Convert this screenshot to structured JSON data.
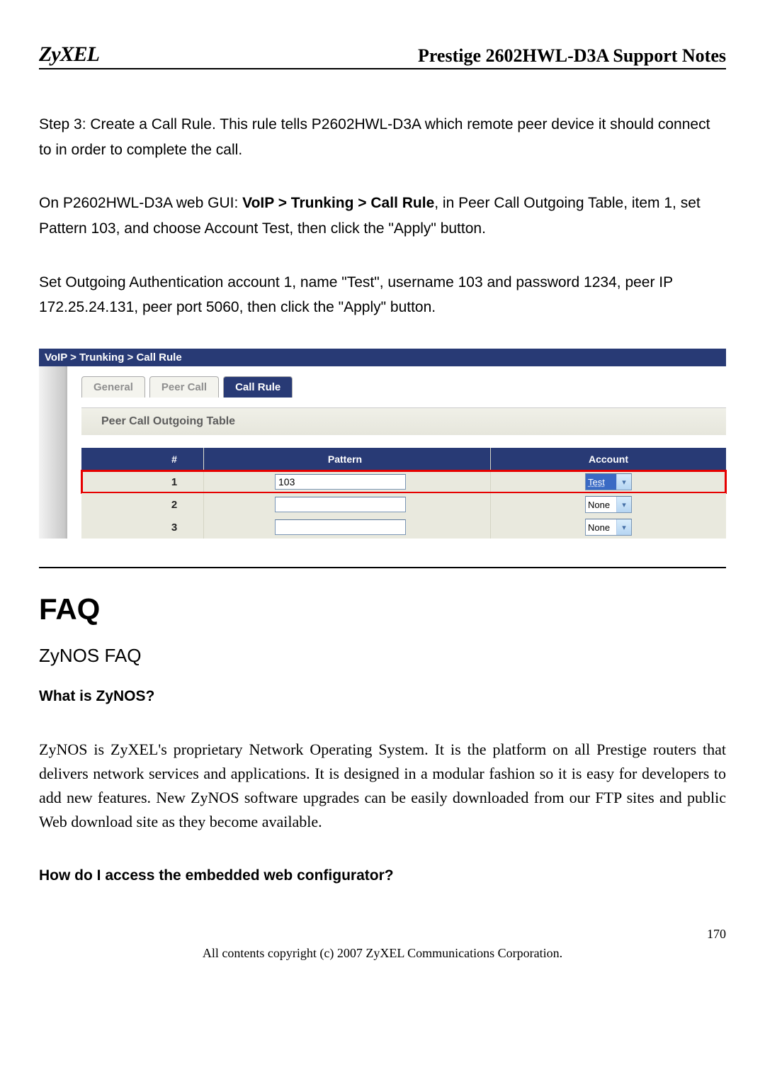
{
  "header": {
    "logo": "ZyXEL",
    "title": "Prestige 2602HWL-D3A Support Notes"
  },
  "body": {
    "p1_a": "Step   3: Create a Call Rule. This rule tells P2602HWL-D3A which remote peer device it should connect to in order to complete the call.",
    "p2_a": "On P2602HWL-D3A web GUI: ",
    "p2_b": "VoIP > Trunking > Call Rule",
    "p2_c": ", in Peer Call Outgoing Table, item 1, set Pattern 103, and choose Account Test, then click the \"Apply\" button.",
    "p3": "Set Outgoing Authentication account 1, name \"Test\", username 103 and password 1234, peer IP 172.25.24.131, peer port 5060, then click the \"Apply\" button."
  },
  "gui": {
    "breadcrumb": "VoIP > Trunking > Call Rule",
    "tabs": [
      "General",
      "Peer Call",
      "Call Rule"
    ],
    "active_tab": 2,
    "section_title": "Peer Call Outgoing Table",
    "columns": {
      "idx": "#",
      "pattern": "Pattern",
      "account": "Account"
    },
    "rows": [
      {
        "idx": "1",
        "pattern": "103",
        "account": "Test",
        "highlight": true
      },
      {
        "idx": "2",
        "pattern": "",
        "account": "None",
        "highlight": false
      },
      {
        "idx": "3",
        "pattern": "",
        "account": "None",
        "highlight": false
      }
    ]
  },
  "faq": {
    "h1": "FAQ",
    "h2": "ZyNOS FAQ",
    "q1": "What is ZyNOS?",
    "a1": "ZyNOS is ZyXEL's proprietary Network Operating System. It is the platform on all Prestige routers that delivers network services and applications. It is designed in a modular fashion so it is easy for developers to add new features. New ZyNOS software upgrades can be easily downloaded from our FTP sites and public Web download site as they become available.",
    "q2": "How do I access the embedded web configurator?"
  },
  "footer": {
    "page": "170",
    "copyright": "All contents copyright (c) 2007 ZyXEL Communications Corporation."
  }
}
